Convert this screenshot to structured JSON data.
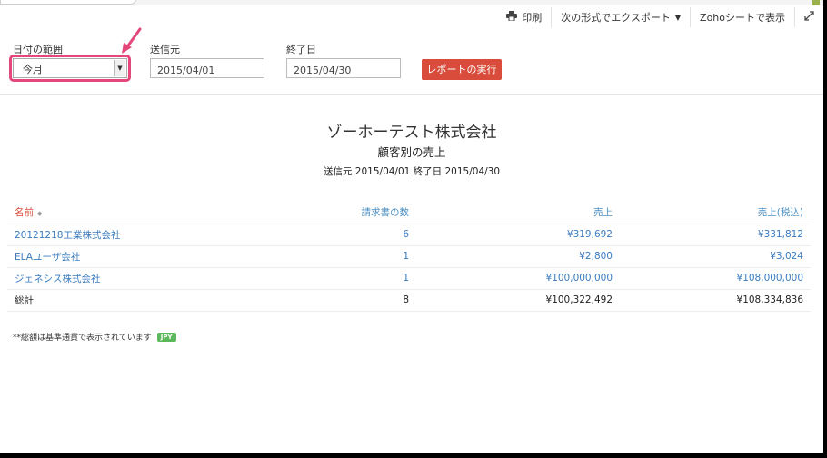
{
  "toolbar": {
    "print_label": "印刷",
    "export_label": "次の形式でエクスポート",
    "zoho_sheet_label": "Zohoシートで表示"
  },
  "filters": {
    "date_range_label": "日付の範囲",
    "date_range_value": "今月",
    "from_label": "送信元",
    "from_value": "2015/04/01",
    "to_label": "終了日",
    "to_value": "2015/04/30",
    "run_label": "レポートの実行"
  },
  "report": {
    "company": "ゾーホーテスト株式会社",
    "title": "顧客別の売上",
    "range_text": "送信元 2015/04/01 終了日 2015/04/30",
    "columns": [
      "名前",
      "請求書の数",
      "売上",
      "売上(税込)"
    ],
    "rows": [
      {
        "name": "20121218工業株式会社",
        "count": "6",
        "sales": "¥319,692",
        "sales_tax": "¥331,812"
      },
      {
        "name": "ELAユーザ会社",
        "count": "1",
        "sales": "¥2,800",
        "sales_tax": "¥3,024"
      },
      {
        "name": "ジェネシス株式会社",
        "count": "1",
        "sales": "¥100,000,000",
        "sales_tax": "¥108,000,000"
      }
    ],
    "total": {
      "name": "総計",
      "count": "8",
      "sales": "¥100,322,492",
      "sales_tax": "¥108,334,836"
    }
  },
  "footnote": {
    "text": "**総額は基準通貨で表示されています",
    "currency_badge": "JPY"
  },
  "colors": {
    "accent_red": "#d94b3a",
    "link_blue": "#3a7bbf",
    "highlight_pink": "#e4487a",
    "badge_green": "#5cb85c"
  }
}
